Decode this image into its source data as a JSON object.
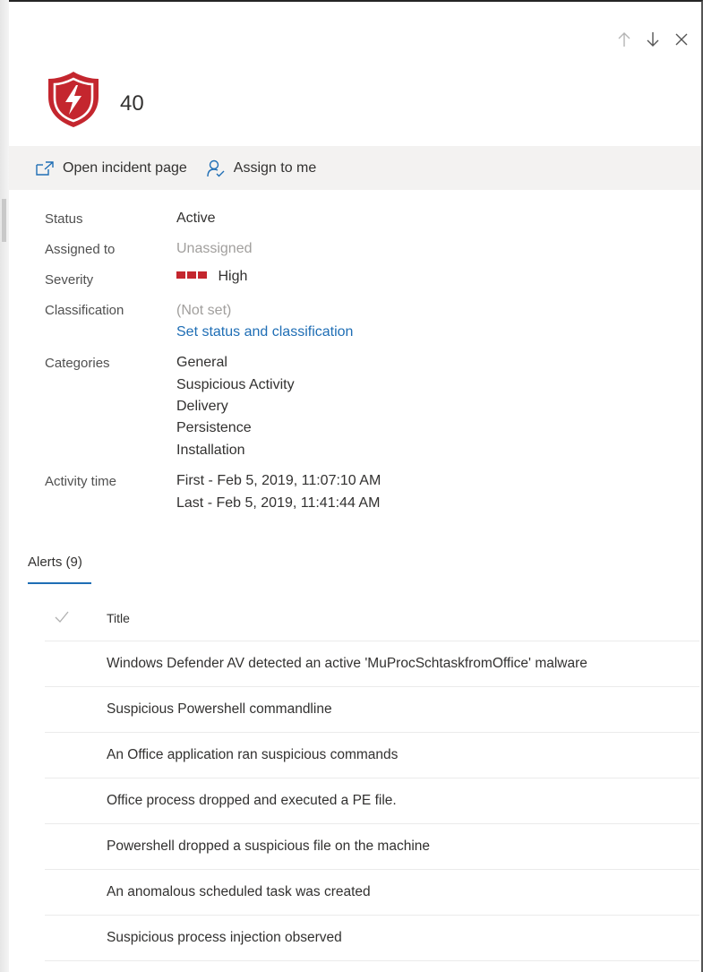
{
  "nav": {
    "up_icon": "arrow-up-icon",
    "down_icon": "arrow-down-icon",
    "close_icon": "close-icon"
  },
  "header": {
    "icon": "shield-lightning-icon",
    "incident_id": "40"
  },
  "commands": {
    "open_incident": "Open incident page",
    "assign_to_me": "Assign to me"
  },
  "details": {
    "status_label": "Status",
    "status_value": "Active",
    "assigned_label": "Assigned to",
    "assigned_value": "Unassigned",
    "severity_label": "Severity",
    "severity_value": "High",
    "severity_color": "#c4262e",
    "classification_label": "Classification",
    "classification_value": "(Not set)",
    "classification_link": "Set status and classification",
    "categories_label": "Categories",
    "categories": [
      "General",
      "Suspicious Activity",
      "Delivery",
      "Persistence",
      "Installation"
    ],
    "activity_label": "Activity time",
    "activity_first": "First - Feb 5, 2019, 11:07:10 AM",
    "activity_last": "Last - Feb 5, 2019, 11:41:44 AM"
  },
  "alerts": {
    "tab_label": "Alerts (9)",
    "column_title": "Title",
    "rows": [
      "Windows Defender AV detected an active 'MuProcSchtaskfromOffice' malware",
      "Suspicious Powershell commandline",
      "An Office application ran suspicious commands",
      "Office process dropped and executed a PE file.",
      "Powershell dropped a suspicious file on the machine",
      "An anomalous scheduled task was created",
      "Suspicious process injection observed"
    ]
  },
  "colors": {
    "accent": "#1f6eb5",
    "brand_red": "#c4262e",
    "command_bar_bg": "#f3f2f1"
  }
}
